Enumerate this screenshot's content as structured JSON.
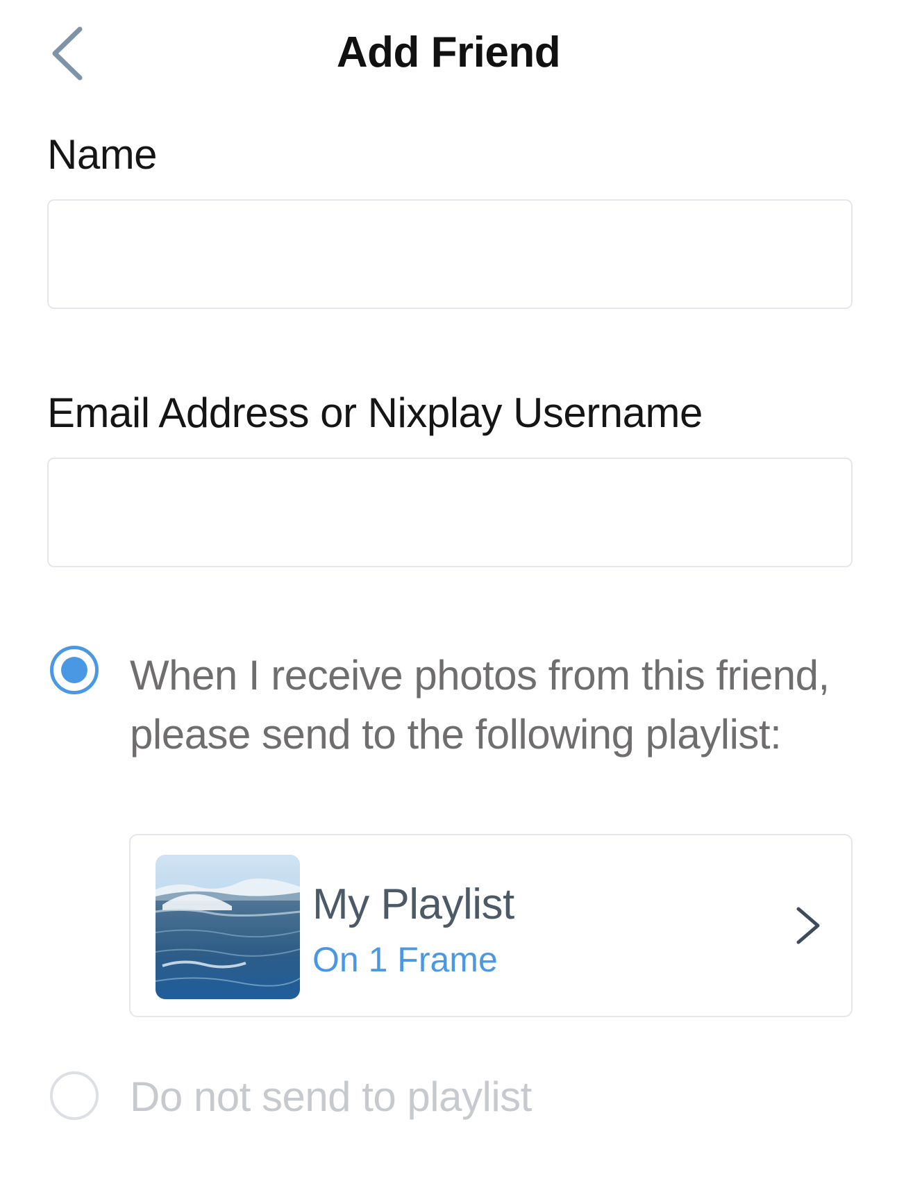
{
  "header": {
    "title": "Add Friend",
    "back_icon": "chevron-left-icon"
  },
  "form": {
    "name_label": "Name",
    "name_value": "",
    "email_label": "Email Address or Nixplay Username",
    "email_value": ""
  },
  "options": {
    "send_to_playlist": {
      "text": "When I receive photos from this friend, please send to the following playlist:",
      "selected": true
    },
    "playlist": {
      "name": "My Playlist",
      "subtitle": "On 1 Frame",
      "thumbnail": "ocean-wave-photo",
      "chevron_icon": "chevron-right-icon"
    },
    "do_not_send": {
      "text": "Do not send to playlist",
      "selected": false
    }
  },
  "colors": {
    "accent": "#4a98e3",
    "back_icon": "#7d94a8",
    "border": "#e3e7ec",
    "text_secondary": "#6f6d6d",
    "text_disabled": "#c6c9cd",
    "playlist_name": "#4c5a68"
  }
}
